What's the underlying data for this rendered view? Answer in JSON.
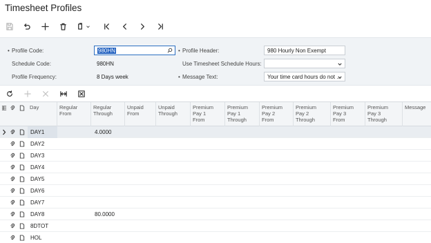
{
  "page": {
    "title": "Timesheet Profiles"
  },
  "toolbar": {
    "items": [
      {
        "name": "save-icon"
      },
      {
        "name": "undo-icon"
      },
      {
        "name": "add-icon"
      },
      {
        "name": "delete-icon"
      },
      {
        "name": "copy-paste-icon"
      },
      {
        "name": "first-record-icon"
      },
      {
        "name": "previous-record-icon"
      },
      {
        "name": "next-record-icon"
      },
      {
        "name": "last-record-icon"
      }
    ]
  },
  "form": {
    "profile_code": {
      "label": "Profile Code:",
      "value": "980HN"
    },
    "schedule_code": {
      "label": "Schedule Code:",
      "value": "980HN"
    },
    "profile_frequency": {
      "label": "Profile Frequency:",
      "value": "8 Days week"
    },
    "profile_header": {
      "label": "Profile Header:",
      "value": "980 Hourly Non Exempt"
    },
    "use_schedule_hours": {
      "label": "Use Timesheet Schedule Hours:",
      "value": ""
    },
    "message_text": {
      "label": "Message Text:",
      "value": "Your time card hours do not ..."
    }
  },
  "grid": {
    "columns": [
      "Day",
      "Regular\nFrom",
      "Regular\nThrough",
      "Unpaid\nFrom",
      "Unpaid\nThrough",
      "Premium\nPay 1\nFrom",
      "Premium\nPay 1\nThrough",
      "Premium\nPay 2\nFrom",
      "Premium\nPay 2\nThrough",
      "Premium\nPay 3\nFrom",
      "Premium\nPay 3\nThrough",
      "Message"
    ],
    "rows": [
      {
        "day": "DAY1",
        "regular_through": "4.0000"
      },
      {
        "day": "DAY2",
        "regular_through": ""
      },
      {
        "day": "DAY3",
        "regular_through": ""
      },
      {
        "day": "DAY4",
        "regular_through": ""
      },
      {
        "day": "DAY5",
        "regular_through": ""
      },
      {
        "day": "DAY6",
        "regular_through": ""
      },
      {
        "day": "DAY7",
        "regular_through": ""
      },
      {
        "day": "DAY8",
        "regular_through": "80.0000"
      },
      {
        "day": "8DTOT",
        "regular_through": ""
      },
      {
        "day": "HOL",
        "regular_through": ""
      }
    ]
  }
}
